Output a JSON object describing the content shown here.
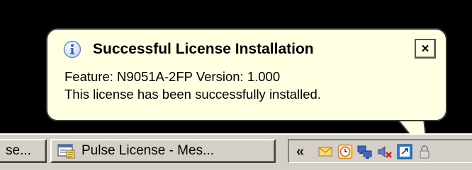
{
  "balloon": {
    "title": "Successful License Installation",
    "close_label": "×",
    "feature_label": "Feature:",
    "feature_value": "N9051A-2FP",
    "version_label": "Version:",
    "version_value": "1.000",
    "message": "This license has been successfully installed."
  },
  "taskbar": {
    "buttons": [
      {
        "label": "se...",
        "icon": "window-icon"
      },
      {
        "label": "Pulse License - Mes...",
        "icon": "message-window-icon"
      }
    ],
    "tray": {
      "chevron": "«",
      "icons": [
        "mail-icon",
        "clock-icon",
        "network-computers-icon",
        "volume-muted-icon",
        "license-manager-icon",
        "lock-icon"
      ]
    }
  },
  "colors": {
    "balloon_background": "#ffffe1",
    "taskbar_background": "#d4d0c8",
    "desktop_background": "#000000",
    "info_icon_blue": "#2a5fc4"
  }
}
